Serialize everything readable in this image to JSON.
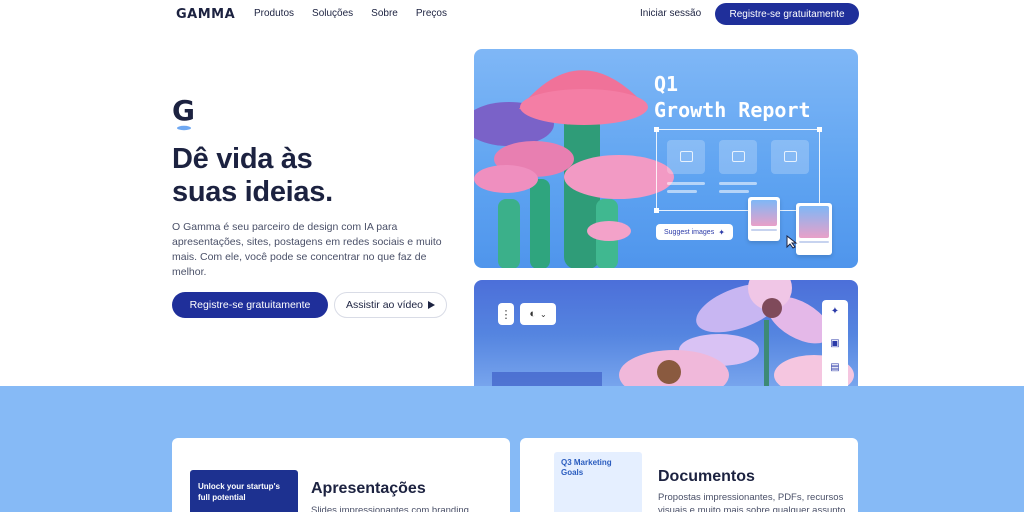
{
  "nav": {
    "logo": "GAMMA",
    "items": [
      "Produtos",
      "Soluções",
      "Sobre",
      "Preços"
    ],
    "login": "Iniciar sessão",
    "cta": "Registre-se gratuitamente"
  },
  "hero": {
    "headline": "Dê vida às\nsuas ideias.",
    "description": "O Gamma é seu parceiro de design com IA para apresentações, sites, postagens em redes sociais e muito mais. Com ele, você pode se concentrar no que faz de melhor.",
    "primary_cta": "Registre-se gratuitamente",
    "secondary_cta": "Assistir ao vídeo"
  },
  "showcase": {
    "title": "Q1\nGrowth Report",
    "suggest_label": "Suggest images"
  },
  "features": [
    {
      "title": "Apresentações",
      "description": "Slides impressionantes com branding",
      "thumb_text": "Unlock your startup's\nfull potential"
    },
    {
      "title": "Documentos",
      "description": "Propostas impressionantes, PDFs, recursos visuais e muito mais sobre qualquer assunto",
      "thumb_text": "Q3 Marketing\nGoals"
    }
  ],
  "colors": {
    "brand": "#1f2f9a",
    "band": "#86baf6",
    "text": "#1c2240"
  }
}
